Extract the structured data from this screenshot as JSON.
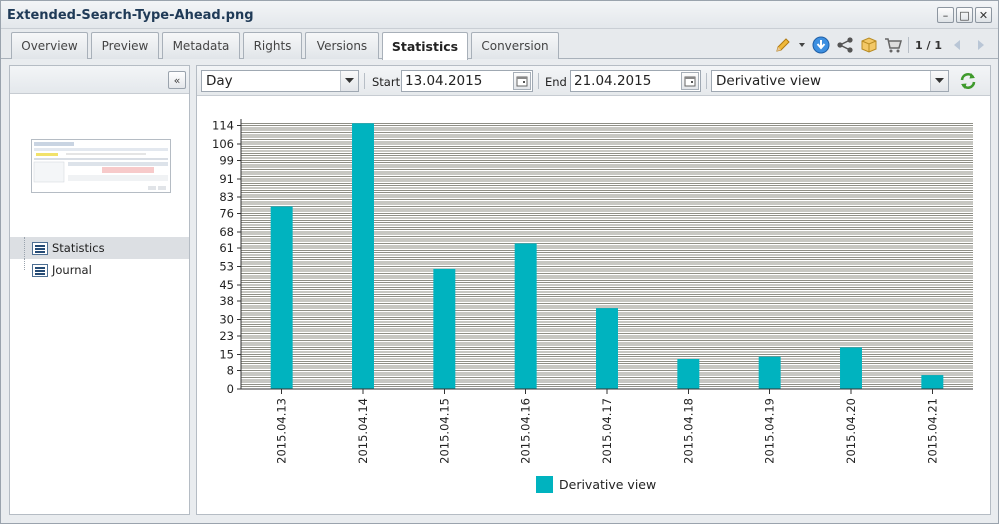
{
  "window": {
    "title": "Extended-Search-Type-Ahead.png"
  },
  "tabs": [
    {
      "label": "Overview"
    },
    {
      "label": "Preview"
    },
    {
      "label": "Metadata"
    },
    {
      "label": "Rights"
    },
    {
      "label": "Versions"
    },
    {
      "label": "Statistics",
      "active": true
    },
    {
      "label": "Conversion"
    }
  ],
  "toolbar": {
    "pager": "1 / 1",
    "icons": [
      "pencil-icon",
      "download-icon",
      "share-icon",
      "box-icon",
      "cart-icon",
      "prev-icon",
      "next-icon"
    ]
  },
  "sidebar": {
    "items": [
      {
        "label": "Statistics",
        "selected": true
      },
      {
        "label": "Journal",
        "selected": false
      }
    ]
  },
  "filters": {
    "interval": "Day",
    "start_label": "Start",
    "start_value": "13.04.2015",
    "end_label": "End",
    "end_value": "21.04.2015",
    "view": "Derivative view"
  },
  "colors": {
    "bar": "#00b3bf",
    "accent": "#1f3a57",
    "grid": "#8f8f86"
  },
  "chart_data": {
    "type": "bar",
    "categories": [
      "2015.04.13",
      "2015.04.14",
      "2015.04.15",
      "2015.04.16",
      "2015.04.17",
      "2015.04.18",
      "2015.04.19",
      "2015.04.20",
      "2015.04.21"
    ],
    "series": [
      {
        "name": "Derivative view",
        "values": [
          79,
          115,
          52,
          63,
          35,
          13,
          14,
          18,
          6
        ]
      }
    ],
    "y_ticks": [
      "0",
      "8",
      "15",
      "23",
      "30",
      "38",
      "45",
      "53",
      "61",
      "68",
      "76",
      "83",
      "91",
      "99",
      "106",
      "114"
    ],
    "ylim": [
      0,
      116
    ],
    "legend": "bottom-center",
    "grid": true
  }
}
